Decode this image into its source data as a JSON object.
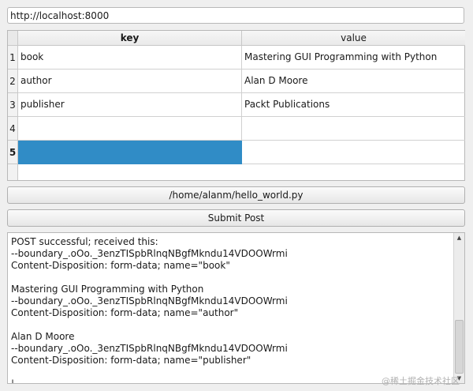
{
  "url_field": {
    "value": "http://localhost:8000"
  },
  "table": {
    "headers": {
      "key": "key",
      "value": "value"
    },
    "rows": [
      {
        "num": "1",
        "key": "book",
        "value": "Mastering GUI Programming with Python"
      },
      {
        "num": "2",
        "key": "author",
        "value": "Alan D Moore"
      },
      {
        "num": "3",
        "key": "publisher",
        "value": "Packt Publications"
      },
      {
        "num": "4",
        "key": "",
        "value": ""
      },
      {
        "num": "5",
        "key": "",
        "value": ""
      }
    ],
    "selection_color": "#308cc6"
  },
  "file_button": {
    "label": "/home/alanm/hello_world.py"
  },
  "submit_button": {
    "label": "Submit Post"
  },
  "output": {
    "text": "POST successful; received this:\n--boundary_.oOo._3enzTISpbRlnqNBgfMkndu14VDOOWrmi\nContent-Disposition: form-data; name=\"book\"\n\nMastering GUI Programming with Python\n--boundary_.oOo._3enzTISpbRlnqNBgfMkndu14VDOOWrmi\nContent-Disposition: form-data; name=\"author\"\n\nAlan D Moore\n--boundary_.oOo._3enzTISpbRlnqNBgfMkndu14VDOOWrmi\nContent-Disposition: form-data; name=\"publisher\"\n\n|"
  },
  "watermark": {
    "text": "@稀土掘金技术社区"
  }
}
